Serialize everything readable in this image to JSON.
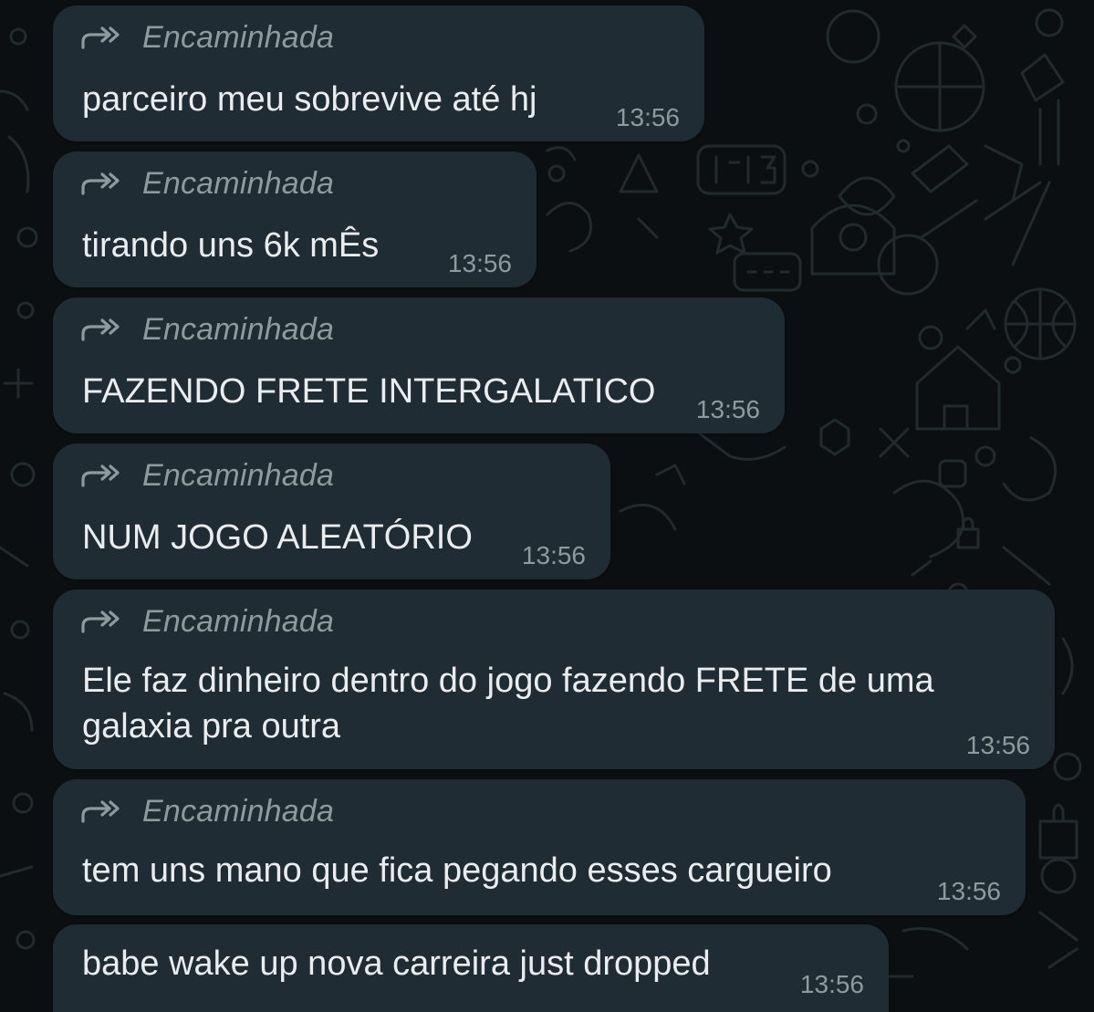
{
  "theme": {
    "background": "#0b0f11",
    "bubble": "#202c33",
    "text": "#e9edef",
    "meta": "#8f9a9f"
  },
  "forward_icon": "forwarded-double-arrow-icon",
  "messages": [
    {
      "forwarded_label": "Encaminhada",
      "text": "parceiro meu sobrevive até hj",
      "time": "13:56"
    },
    {
      "forwarded_label": "Encaminhada",
      "text": "tirando uns 6k mÊs",
      "time": "13:56"
    },
    {
      "forwarded_label": "Encaminhada",
      "text": "FAZENDO FRETE INTERGALATICO",
      "time": "13:56"
    },
    {
      "forwarded_label": "Encaminhada",
      "text": "NUM JOGO ALEATÓRIO",
      "time": "13:56"
    },
    {
      "forwarded_label": "Encaminhada",
      "text_line1": "Ele faz dinheiro dentro do jogo fazendo FRETE de uma",
      "text_line2": "galaxia pra outra",
      "time": "13:56"
    },
    {
      "forwarded_label": "Encaminhada",
      "text": "tem uns mano que fica pegando esses cargueiro",
      "time": "13:56"
    },
    {
      "text": "babe wake up nova carreira just dropped",
      "time": "13:56"
    }
  ]
}
